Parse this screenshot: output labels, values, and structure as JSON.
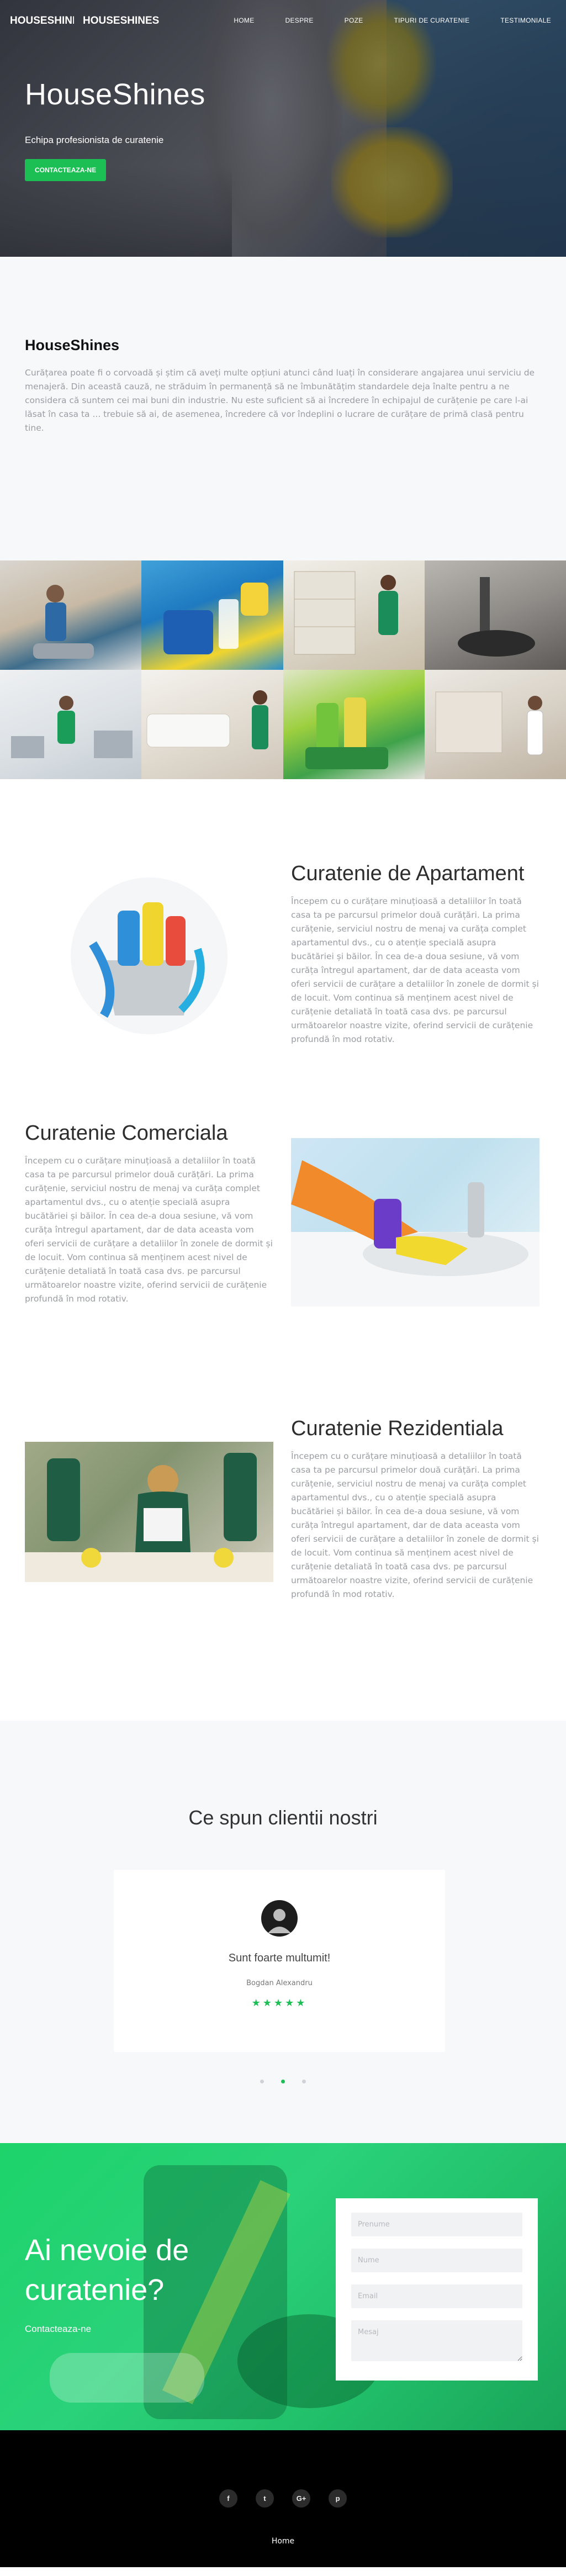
{
  "nav": {
    "brand_primary": "HOUSESHINES",
    "brand_secondary": "HOUSESHINES",
    "items": [
      {
        "label": "HOME"
      },
      {
        "label": "DESPRE"
      },
      {
        "label": "POZE"
      },
      {
        "label": "TIPURI DE CURATENIE"
      },
      {
        "label": "TESTIMONIALE"
      }
    ]
  },
  "hero": {
    "title": "HouseShines",
    "subtitle": "Echipa profesionista de curatenie",
    "cta_label": "CONTACTEAZA-NE"
  },
  "about": {
    "title": "HouseShines",
    "body": "Curățarea poate fi o corvoadă și știm că aveți multe opțiuni atunci când luați în considerare angajarea unui serviciu de menajeră. Din această cauză, ne străduim în permanență să ne îmbunătățim standardele deja înalte pentru a ne considera că suntem cei mai buni din industrie. Nu este suficient să ai încredere în echipajul de curățenie pe care l-ai lăsat în casa ta ... trebuie să ai, de asemenea, încredere că vor îndeplini o lucrare de curățare de primă clasă pentru tine."
  },
  "gallery": {
    "images": [
      {
        "name": "photo-cleaner-floor-machine"
      },
      {
        "name": "photo-cleaning-supplies-bucket"
      },
      {
        "name": "photo-cleaner-shelves"
      },
      {
        "name": "photo-vacuum-closeup"
      },
      {
        "name": "photo-cleaner-office"
      },
      {
        "name": "photo-vacuum-living-room"
      },
      {
        "name": "photo-cleaning-caddy"
      },
      {
        "name": "photo-cleaner-kitchen"
      }
    ]
  },
  "services": [
    {
      "title": "Curatenie de Apartament",
      "body": "Începem cu o curățare minuțioasă a detaliilor în toată casa ta pe parcursul primelor două curățări. La prima curățenie, serviciul nostru de menaj va curăța complet apartamentul dvs., cu o atenție specială asupra bucătăriei și băilor. În cea de-a doua sesiune, vă vom curăța întregul apartament, dar de data aceasta vom oferi servicii de curățare a detaliilor în zonele de dormit și de locuit. Vom continua să menținem acest nivel de curățenie detaliată în toată casa dvs. pe parcursul următoarelor noastre vizite, oferind servicii de curățenie profundă în mod rotativ."
    },
    {
      "title": "Curatenie Comerciala",
      "body": "Începem cu o curățare minuțioasă a detaliilor în toată casa ta pe parcursul primelor două curățări. La prima curățenie, serviciul nostru de menaj va curăța complet apartamentul dvs., cu o atenție specială asupra bucătăriei și băilor. În cea de-a doua sesiune, vă vom curăța întregul apartament, dar de data aceasta vom oferi servicii de curățare a detaliilor în zonele de dormit și de locuit. Vom continua să menținem acest nivel de curățenie detaliată în toată casa dvs. pe parcursul următoarelor noastre vizite, oferind servicii de curățenie profundă în mod rotativ."
    },
    {
      "title": "Curatenie Rezidentiala",
      "body": "Începem cu o curățare minuțioasă a detaliilor în toată casa ta pe parcursul primelor două curățări. La prima curățenie, serviciul nostru de menaj va curăța complet apartamentul dvs., cu o atenție specială asupra bucătăriei și băilor. În cea de-a doua sesiune, vă vom curăța întregul apartament, dar de data aceasta vom oferi servicii de curățare a detaliilor în zonele de dormit și de locuit. Vom continua să menținem acest nivel de curățenie detaliată în toată casa dvs. pe parcursul următoarelor noastre vizite, oferind servicii de curățenie profundă în mod rotativ."
    }
  ],
  "testimonials": {
    "title": "Ce spun clientii nostri",
    "quote": "Sunt foarte multumit!",
    "author": "Bogdan Alexandru",
    "stars": "★★★★★",
    "rating": 5,
    "active_dot": 2,
    "dot_count": 3
  },
  "contact": {
    "title": "Ai nevoie de curatenie?",
    "subtitle": "Contacteaza-ne",
    "fields": {
      "first_name_placeholder": "Prenume",
      "last_name_placeholder": "Nume",
      "email_placeholder": "Email",
      "message_placeholder": "Mesaj"
    }
  },
  "footer": {
    "social": [
      {
        "glyph": "f",
        "name": "facebook-icon"
      },
      {
        "glyph": "t",
        "name": "twitter-icon"
      },
      {
        "glyph": "G+",
        "name": "google-plus-icon"
      },
      {
        "glyph": "p",
        "name": "pinterest-icon"
      }
    ],
    "link": "Home"
  },
  "colors": {
    "accent": "#1bbf54",
    "dark": "#000000",
    "muted_text": "#9a9da3",
    "section_bg": "#f7f8fa"
  }
}
